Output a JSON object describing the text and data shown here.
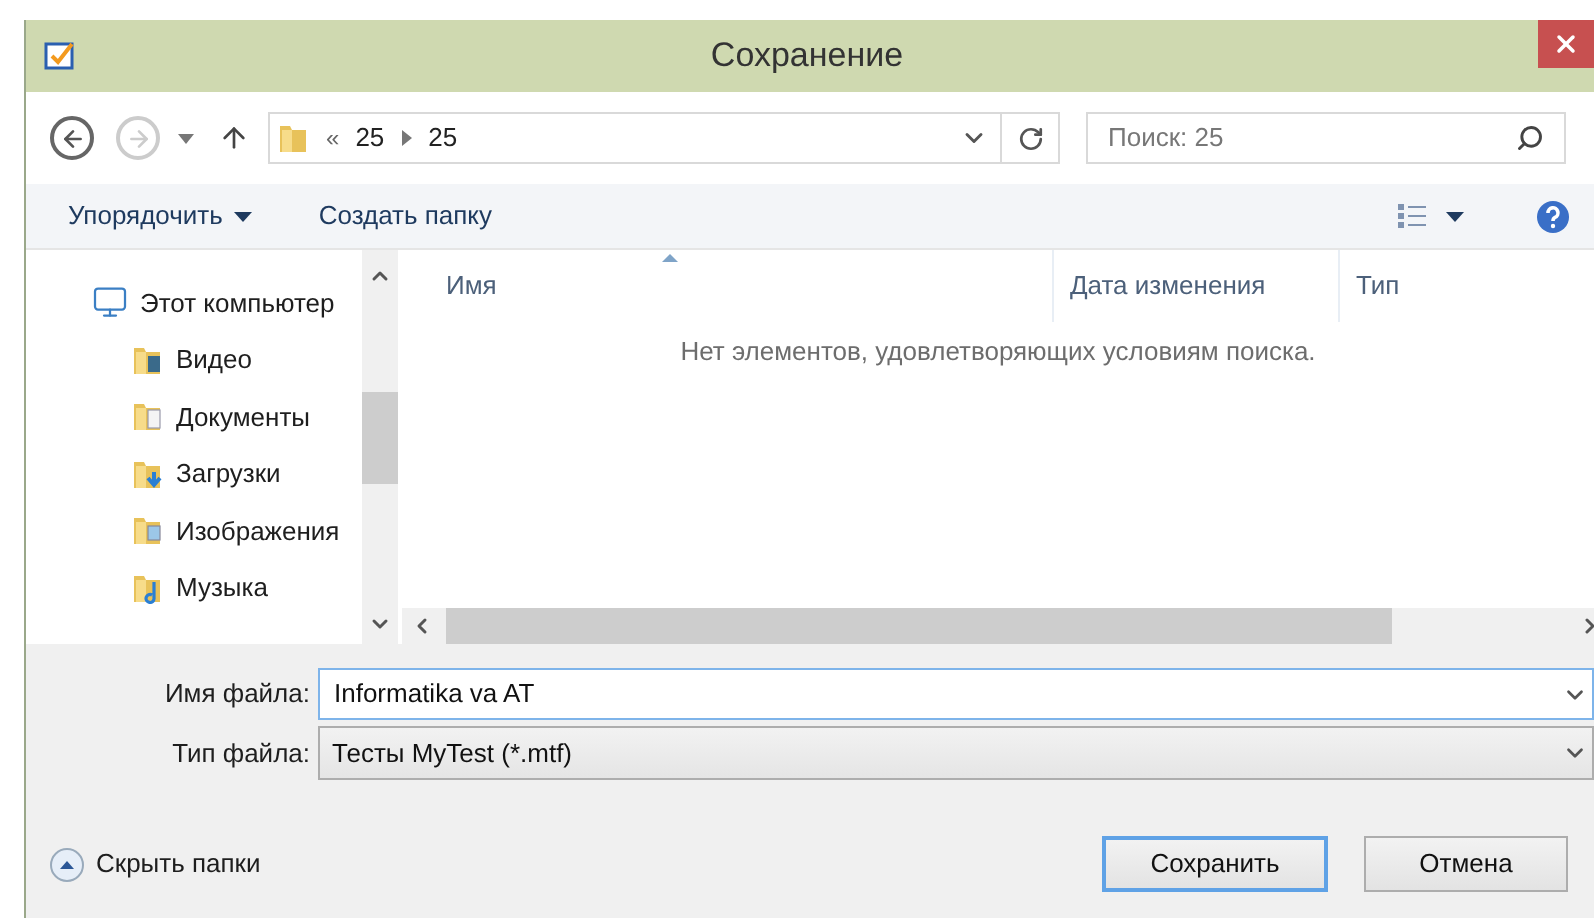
{
  "window": {
    "title": "Сохранение"
  },
  "address": {
    "overflow": "«",
    "segments": [
      "25",
      "25"
    ]
  },
  "search": {
    "placeholder": "Поиск: 25"
  },
  "toolbar": {
    "buttons": [
      {
        "label": "Упорядочить",
        "kind": "menu"
      },
      {
        "label": "Создать папку",
        "kind": "plain"
      }
    ]
  },
  "nav_tree": {
    "items": [
      {
        "label": "Этот компьютер",
        "kind": "computer",
        "children": [
          {
            "label": "Видео",
            "kind": "video"
          },
          {
            "label": "Документы",
            "kind": "documents"
          },
          {
            "label": "Загрузки",
            "kind": "downloads"
          },
          {
            "label": "Изображения",
            "kind": "pictures"
          },
          {
            "label": "Музыка",
            "kind": "music"
          }
        ]
      }
    ]
  },
  "file_list": {
    "columns": [
      {
        "label": "Имя",
        "sorted": true
      },
      {
        "label": "Дата изменения",
        "sorted": false
      },
      {
        "label": "Тип",
        "sorted": false
      }
    ],
    "empty_message": "Нет элементов, удовлетворяющих условиям поиска."
  },
  "file_name": {
    "label": "Имя файла:",
    "value": "Informatika va AT"
  },
  "file_type": {
    "label": "Тип файла:",
    "value": "Тесты MyTest (*.mtf)"
  },
  "hide_folders": {
    "label": "Скрыть папки"
  },
  "buttons": [
    {
      "label": "Сохранить",
      "default": true
    },
    {
      "label": "Отмена",
      "default": false
    }
  ]
}
